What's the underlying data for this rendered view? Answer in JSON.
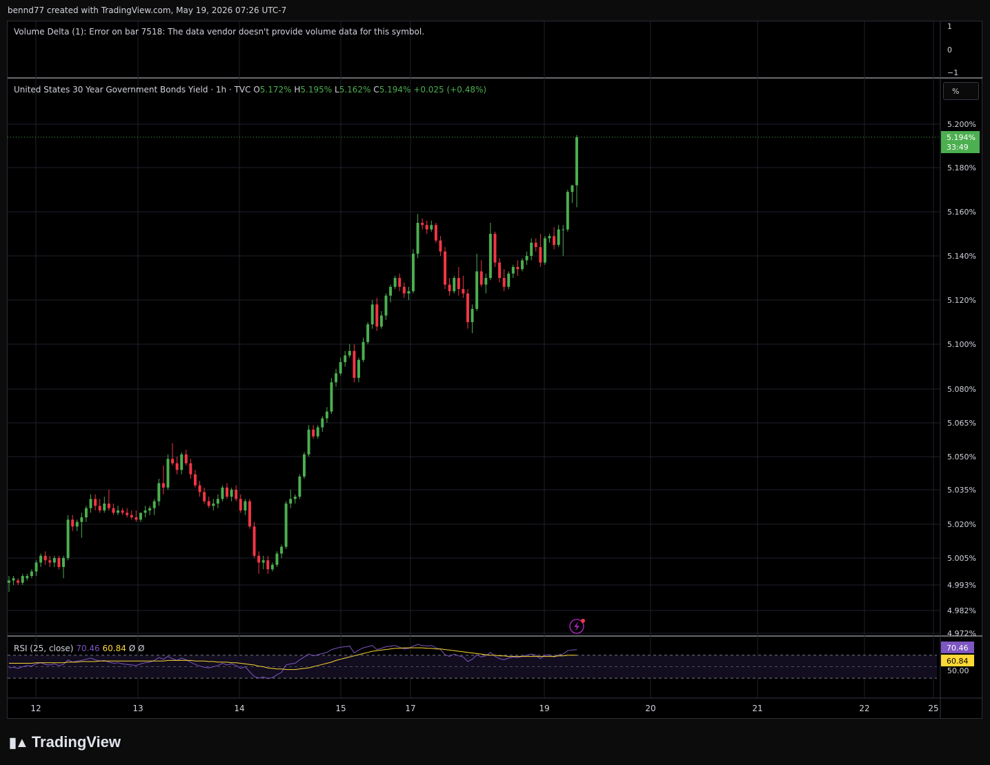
{
  "header": {
    "attribution": "bennd77 created with TradingView.com, May 19, 2026 07:26 UTC-7"
  },
  "volume_delta": {
    "error": "Volume Delta (1): Error on bar 7518: The data vendor doesn't provide volume data for this symbol.",
    "scale": [
      "1",
      "0",
      "−1"
    ]
  },
  "legend": {
    "symbol": "United States 30 Year Government Bonds Yield · 1h · TVC",
    "o_label": "O",
    "o": "5.172%",
    "h_label": "H",
    "h": "5.195%",
    "l_label": "L",
    "l": "5.162%",
    "c_label": "C",
    "c": "5.194%",
    "change": "+0.025 (+0.48%)"
  },
  "scale_button": "%",
  "price_tag": {
    "value": "5.194%",
    "countdown": "33:49"
  },
  "rsi": {
    "label": "RSI (25, close)",
    "value": "70.46",
    "ma": "60.84",
    "na1": "Ø",
    "na2": "Ø",
    "axis_label": "50.00",
    "tag_rsi": "70.46",
    "tag_ma": "60.84"
  },
  "brand": {
    "name": "TradingView"
  },
  "colors": {
    "up": "#4caf50",
    "down": "#f23645",
    "rsi": "#7e57c2",
    "rsi_ma": "#fdd835",
    "grid": "#1f222b"
  },
  "chart_data": {
    "type": "candlestick",
    "title": "United States 30 Year Government Bonds Yield",
    "interval": "1h",
    "ylabel": "%",
    "y_ticks": [
      5.2,
      5.18,
      5.16,
      5.14,
      5.12,
      5.1,
      5.08,
      5.065,
      5.05,
      5.035,
      5.02,
      5.005,
      4.993,
      4.982,
      4.972
    ],
    "y_tick_labels": [
      "5.200%",
      "5.180%",
      "5.160%",
      "5.140%",
      "5.120%",
      "5.100%",
      "5.080%",
      "5.065%",
      "5.050%",
      "5.035%",
      "5.020%",
      "5.005%",
      "4.993%",
      "4.982%",
      "4.972%"
    ],
    "x_ticks": [
      "12",
      "13",
      "14",
      "15",
      "17",
      "19",
      "20",
      "21",
      "22",
      "25"
    ],
    "ohlc": [
      [
        4.994,
        4.997,
        4.99,
        4.995
      ],
      [
        4.995,
        4.997,
        4.993,
        4.996
      ],
      [
        4.995,
        4.996,
        4.993,
        4.994
      ],
      [
        4.994,
        4.998,
        4.993,
        4.997
      ],
      [
        4.996,
        4.998,
        4.995,
        4.997
      ],
      [
        4.997,
        5.0,
        4.996,
        4.999
      ],
      [
        4.999,
        5.004,
        4.997,
        5.003
      ],
      [
        5.003,
        5.007,
        5.001,
        5.006
      ],
      [
        5.006,
        5.008,
        5.002,
        5.004
      ],
      [
        5.004,
        5.006,
        5.001,
        5.003
      ],
      [
        5.003,
        5.006,
        5.001,
        5.005
      ],
      [
        5.005,
        5.006,
        5.0,
        5.001
      ],
      [
        5.001,
        5.006,
        4.996,
        5.005
      ],
      [
        5.005,
        5.024,
        5.004,
        5.022
      ],
      [
        5.022,
        5.024,
        5.017,
        5.019
      ],
      [
        5.019,
        5.022,
        5.017,
        5.021
      ],
      [
        5.021,
        5.025,
        5.014,
        5.023
      ],
      [
        5.023,
        5.028,
        5.021,
        5.027
      ],
      [
        5.027,
        5.033,
        5.025,
        5.031
      ],
      [
        5.031,
        5.033,
        5.026,
        5.028
      ],
      [
        5.028,
        5.031,
        5.025,
        5.026
      ],
      [
        5.026,
        5.032,
        5.025,
        5.029
      ],
      [
        5.029,
        5.035,
        5.026,
        5.027
      ],
      [
        5.027,
        5.029,
        5.024,
        5.025
      ],
      [
        5.025,
        5.028,
        5.024,
        5.026
      ],
      [
        5.026,
        5.027,
        5.024,
        5.025
      ],
      [
        5.025,
        5.027,
        5.023,
        5.024
      ],
      [
        5.024,
        5.026,
        5.022,
        5.023
      ],
      [
        5.023,
        5.026,
        5.021,
        5.022
      ],
      [
        5.022,
        5.025,
        5.021,
        5.025
      ],
      [
        5.025,
        5.028,
        5.023,
        5.026
      ],
      [
        5.026,
        5.028,
        5.024,
        5.027
      ],
      [
        5.027,
        5.031,
        5.024,
        5.03
      ],
      [
        5.03,
        5.04,
        5.028,
        5.038
      ],
      [
        5.038,
        5.046,
        5.033,
        5.036
      ],
      [
        5.036,
        5.051,
        5.035,
        5.049
      ],
      [
        5.049,
        5.056,
        5.046,
        5.047
      ],
      [
        5.047,
        5.05,
        5.042,
        5.044
      ],
      [
        5.044,
        5.052,
        5.042,
        5.051
      ],
      [
        5.051,
        5.053,
        5.046,
        5.047
      ],
      [
        5.047,
        5.049,
        5.04,
        5.042
      ],
      [
        5.042,
        5.044,
        5.036,
        5.037
      ],
      [
        5.037,
        5.039,
        5.032,
        5.034
      ],
      [
        5.034,
        5.036,
        5.029,
        5.03
      ],
      [
        5.03,
        5.032,
        5.027,
        5.028
      ],
      [
        5.028,
        5.031,
        5.026,
        5.029
      ],
      [
        5.029,
        5.033,
        5.027,
        5.031
      ],
      [
        5.031,
        5.037,
        5.03,
        5.036
      ],
      [
        5.036,
        5.038,
        5.031,
        5.032
      ],
      [
        5.032,
        5.036,
        5.03,
        5.035
      ],
      [
        5.035,
        5.037,
        5.03,
        5.031
      ],
      [
        5.031,
        5.033,
        5.025,
        5.026
      ],
      [
        5.026,
        5.031,
        5.024,
        5.03
      ],
      [
        5.03,
        5.031,
        5.018,
        5.019
      ],
      [
        5.019,
        5.021,
        5.005,
        5.006
      ],
      [
        5.006,
        5.008,
        4.998,
        5.003
      ],
      [
        5.003,
        5.006,
        5.0,
        5.004
      ],
      [
        5.004,
        5.006,
        4.998,
        5.0
      ],
      [
        5.0,
        5.003,
        4.999,
        5.002
      ],
      [
        5.002,
        5.008,
        5.001,
        5.007
      ],
      [
        5.007,
        5.011,
        5.005,
        5.01
      ],
      [
        5.01,
        5.03,
        5.009,
        5.029
      ],
      [
        5.029,
        5.035,
        5.027,
        5.031
      ],
      [
        5.031,
        5.033,
        5.029,
        5.032
      ],
      [
        5.032,
        5.042,
        5.031,
        5.041
      ],
      [
        5.041,
        5.052,
        5.04,
        5.051
      ],
      [
        5.051,
        5.064,
        5.05,
        5.062
      ],
      [
        5.062,
        5.064,
        5.058,
        5.059
      ],
      [
        5.059,
        5.064,
        5.058,
        5.063
      ],
      [
        5.063,
        5.068,
        5.061,
        5.067
      ],
      [
        5.067,
        5.072,
        5.065,
        5.07
      ],
      [
        5.07,
        5.085,
        5.069,
        5.083
      ],
      [
        5.083,
        5.089,
        5.081,
        5.087
      ],
      [
        5.087,
        5.094,
        5.086,
        5.092
      ],
      [
        5.092,
        5.097,
        5.09,
        5.095
      ],
      [
        5.095,
        5.1,
        5.094,
        5.097
      ],
      [
        5.097,
        5.1,
        5.083,
        5.085
      ],
      [
        5.085,
        5.094,
        5.083,
        5.093
      ],
      [
        5.093,
        5.103,
        5.092,
        5.101
      ],
      [
        5.101,
        5.11,
        5.1,
        5.109
      ],
      [
        5.109,
        5.12,
        5.107,
        5.118
      ],
      [
        5.118,
        5.121,
        5.106,
        5.108
      ],
      [
        5.108,
        5.115,
        5.107,
        5.113
      ],
      [
        5.113,
        5.123,
        5.111,
        5.122
      ],
      [
        5.122,
        5.127,
        5.119,
        5.126
      ],
      [
        5.126,
        5.131,
        5.125,
        5.13
      ],
      [
        5.13,
        5.132,
        5.124,
        5.126
      ],
      [
        5.126,
        5.128,
        5.121,
        5.123
      ],
      [
        5.123,
        5.126,
        5.12,
        5.124
      ],
      [
        5.124,
        5.143,
        5.123,
        5.141
      ],
      [
        5.141,
        5.159,
        5.139,
        5.155
      ],
      [
        5.155,
        5.157,
        5.152,
        5.154
      ],
      [
        5.154,
        5.156,
        5.15,
        5.152
      ],
      [
        5.152,
        5.156,
        5.151,
        5.154
      ],
      [
        5.154,
        5.155,
        5.146,
        5.147
      ],
      [
        5.147,
        5.149,
        5.14,
        5.142
      ],
      [
        5.142,
        5.144,
        5.125,
        5.127
      ],
      [
        5.127,
        5.13,
        5.122,
        5.124
      ],
      [
        5.124,
        5.131,
        5.123,
        5.13
      ],
      [
        5.13,
        5.135,
        5.122,
        5.125
      ],
      [
        5.125,
        5.131,
        5.121,
        5.123
      ],
      [
        5.123,
        5.125,
        5.107,
        5.11
      ],
      [
        5.11,
        5.118,
        5.105,
        5.116
      ],
      [
        5.116,
        5.141,
        5.115,
        5.133
      ],
      [
        5.133,
        5.138,
        5.126,
        5.127
      ],
      [
        5.127,
        5.132,
        5.123,
        5.13
      ],
      [
        5.13,
        5.155,
        5.129,
        5.15
      ],
      [
        5.15,
        5.151,
        5.135,
        5.137
      ],
      [
        5.137,
        5.139,
        5.128,
        5.13
      ],
      [
        5.13,
        5.134,
        5.124,
        5.126
      ],
      [
        5.126,
        5.133,
        5.125,
        5.132
      ],
      [
        5.132,
        5.136,
        5.13,
        5.135
      ],
      [
        5.135,
        5.138,
        5.131,
        5.134
      ],
      [
        5.134,
        5.139,
        5.133,
        5.138
      ],
      [
        5.138,
        5.142,
        5.136,
        5.14
      ],
      [
        5.14,
        5.148,
        5.138,
        5.146
      ],
      [
        5.146,
        5.148,
        5.142,
        5.144
      ],
      [
        5.144,
        5.15,
        5.135,
        5.137
      ],
      [
        5.137,
        5.149,
        5.136,
        5.148
      ],
      [
        5.148,
        5.15,
        5.146,
        5.149
      ],
      [
        5.149,
        5.153,
        5.143,
        5.145
      ],
      [
        5.145,
        5.154,
        5.144,
        5.152
      ],
      [
        5.152,
        5.154,
        5.14,
        5.152
      ],
      [
        5.152,
        5.17,
        5.151,
        5.169
      ],
      [
        5.169,
        5.172,
        5.164,
        5.172
      ],
      [
        5.172,
        5.195,
        5.162,
        5.194
      ]
    ],
    "rsi_values": [
      48,
      49,
      47,
      50,
      52,
      51,
      55,
      57,
      54,
      53,
      55,
      52,
      54,
      62,
      58,
      60,
      61,
      63,
      65,
      62,
      60,
      61,
      58,
      56,
      57,
      55,
      54,
      53,
      52,
      55,
      57,
      58,
      61,
      66,
      63,
      68,
      64,
      61,
      65,
      62,
      58,
      54,
      51,
      49,
      48,
      50,
      52,
      56,
      53,
      55,
      52,
      47,
      50,
      41,
      33,
      30,
      32,
      29,
      31,
      36,
      40,
      53,
      55,
      56,
      62,
      67,
      72,
      69,
      71,
      73,
      75,
      80,
      82,
      84,
      85,
      86,
      74,
      79,
      83,
      85,
      87,
      80,
      82,
      85,
      86,
      87,
      84,
      81,
      82,
      86,
      89,
      87,
      86,
      87,
      83,
      80,
      71,
      68,
      72,
      69,
      67,
      59,
      63,
      71,
      67,
      69,
      75,
      68,
      64,
      62,
      65,
      67,
      66,
      68,
      70,
      72,
      70,
      64,
      70,
      71,
      67,
      71,
      72,
      78,
      79,
      80
    ],
    "rsi_ma_values": [
      56,
      56,
      56,
      56,
      56,
      56,
      57,
      57,
      57,
      57,
      57,
      57,
      57,
      58,
      58,
      58,
      59,
      59,
      59,
      59,
      60,
      60,
      60,
      60,
      60,
      60,
      60,
      60,
      60,
      60,
      60,
      60,
      60,
      60,
      60,
      61,
      61,
      61,
      61,
      61,
      61,
      60,
      60,
      60,
      59,
      59,
      58,
      58,
      58,
      57,
      57,
      56,
      55,
      54,
      53,
      51,
      50,
      48,
      47,
      46,
      46,
      45,
      45,
      45,
      46,
      47,
      48,
      50,
      52,
      54,
      56,
      58,
      61,
      63,
      65,
      67,
      69,
      71,
      73,
      75,
      77,
      78,
      79,
      80,
      81,
      82,
      82,
      83,
      83,
      83,
      83,
      83,
      82,
      82,
      81,
      81,
      80,
      79,
      78,
      77,
      76,
      75,
      74,
      73,
      72,
      71,
      70,
      70,
      69,
      69,
      68,
      68,
      68,
      68,
      68,
      68,
      68,
      68,
      68,
      68,
      68,
      69,
      69,
      70,
      70,
      70
    ],
    "rsi_levels": [
      70,
      50,
      30
    ]
  }
}
